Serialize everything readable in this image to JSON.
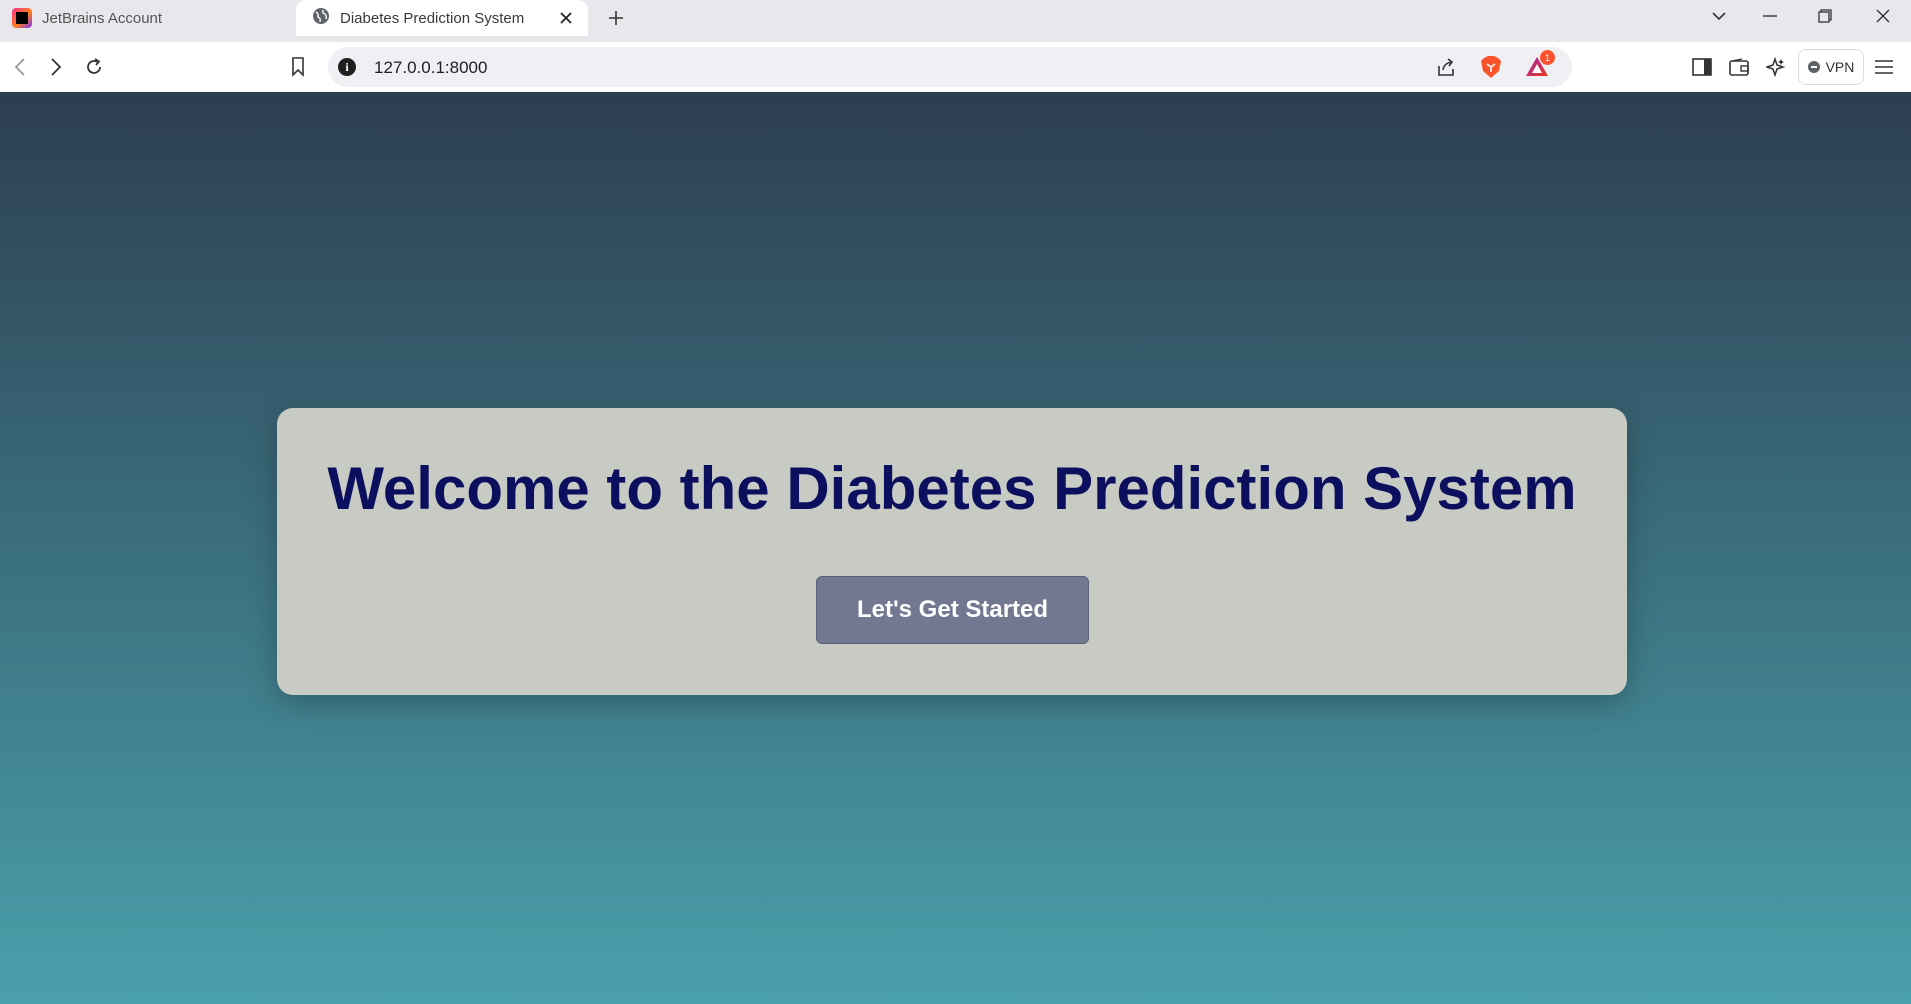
{
  "browser": {
    "tabs": [
      {
        "label": "JetBrains Account",
        "icon": "jetbrains-icon",
        "active": false
      },
      {
        "label": "Diabetes Prediction System",
        "icon": "globe-icon",
        "active": true
      }
    ],
    "url": "127.0.0.1:8000",
    "notification_count": "1",
    "vpn_label": "VPN"
  },
  "page": {
    "heading": "Welcome to the Diabetes Prediction System",
    "cta_label": "Let's Get Started"
  },
  "colors": {
    "gradient_top": "#2c3e50",
    "gradient_bottom": "#4aa0ac",
    "card_bg": "#c7cbc3",
    "heading": "#0b0f5e",
    "button_bg": "#737891"
  }
}
